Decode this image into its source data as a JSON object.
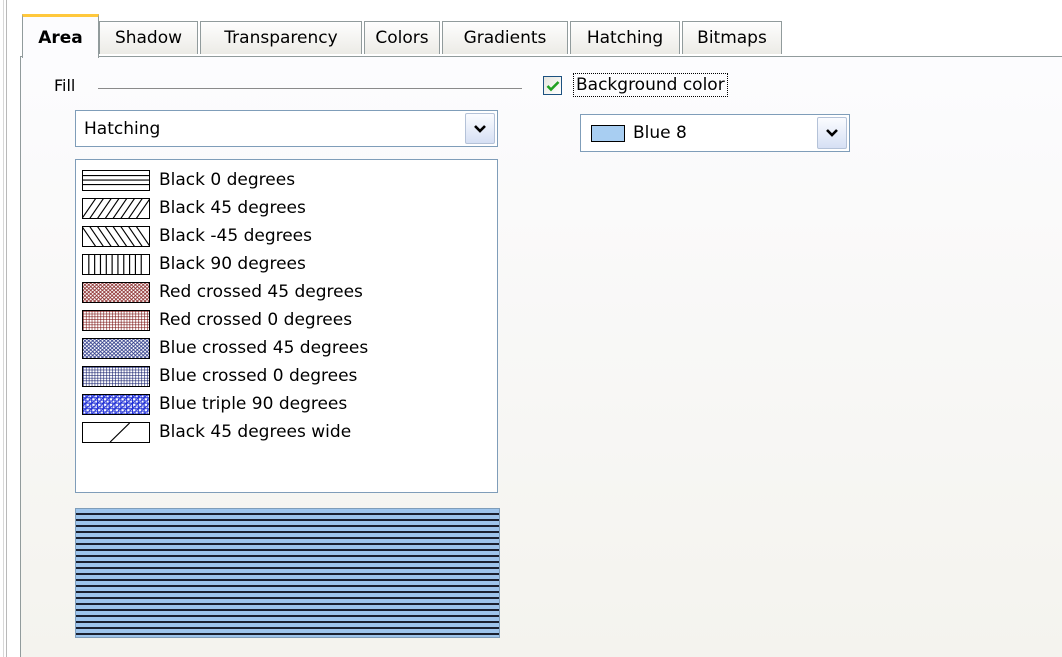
{
  "tabs": [
    {
      "label": "Area",
      "active": true
    },
    {
      "label": "Shadow",
      "active": false
    },
    {
      "label": "Transparency",
      "active": false
    },
    {
      "label": "Colors",
      "active": false
    },
    {
      "label": "Gradients",
      "active": false
    },
    {
      "label": "Hatching",
      "active": false
    },
    {
      "label": "Bitmaps",
      "active": false
    }
  ],
  "fill": {
    "section_label": "Fill",
    "type_value": "Hatching",
    "hatch_list": [
      {
        "label": "Black 0 degrees",
        "icon": "black-0-hatch-icon"
      },
      {
        "label": "Black 45 degrees",
        "icon": "black-45-hatch-icon"
      },
      {
        "label": "Black -45 degrees",
        "icon": "black-minus45-hatch-icon"
      },
      {
        "label": "Black 90 degrees",
        "icon": "black-90-hatch-icon"
      },
      {
        "label": "Red crossed 45 degrees",
        "icon": "red-crossed-45-hatch-icon"
      },
      {
        "label": "Red crossed 0 degrees",
        "icon": "red-crossed-0-hatch-icon"
      },
      {
        "label": "Blue crossed 45 degrees",
        "icon": "blue-crossed-45-hatch-icon"
      },
      {
        "label": "Blue crossed 0 degrees",
        "icon": "blue-crossed-0-hatch-icon"
      },
      {
        "label": "Blue triple 90 degrees",
        "icon": "blue-triple-90-hatch-icon"
      },
      {
        "label": "Black 45 degrees wide",
        "icon": "black-45-wide-hatch-icon"
      }
    ]
  },
  "background": {
    "checkbox_label": "Background color",
    "checked": true,
    "color_value": "Blue 8",
    "color_hex": "#a8cef2"
  },
  "colors": {
    "tab_accent": "#ffc83c",
    "border": "#7f9db9",
    "check_green": "#21a121"
  }
}
